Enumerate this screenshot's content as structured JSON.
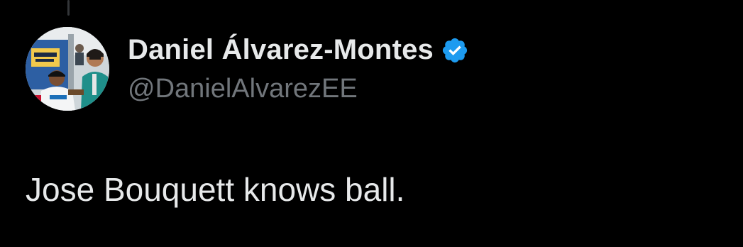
{
  "tweet": {
    "author": {
      "display_name": "Daniel Álvarez-Montes",
      "handle": "@DanielAlvarezEE",
      "verified": true,
      "avatar_icon": "profile-photo"
    },
    "text": "Jose Bouquett knows ball."
  },
  "colors": {
    "background": "#000000",
    "primary_text": "#e7e9ea",
    "secondary_text": "#71767b",
    "verified_badge": "#1d9bf0",
    "thread_line": "#333639"
  }
}
